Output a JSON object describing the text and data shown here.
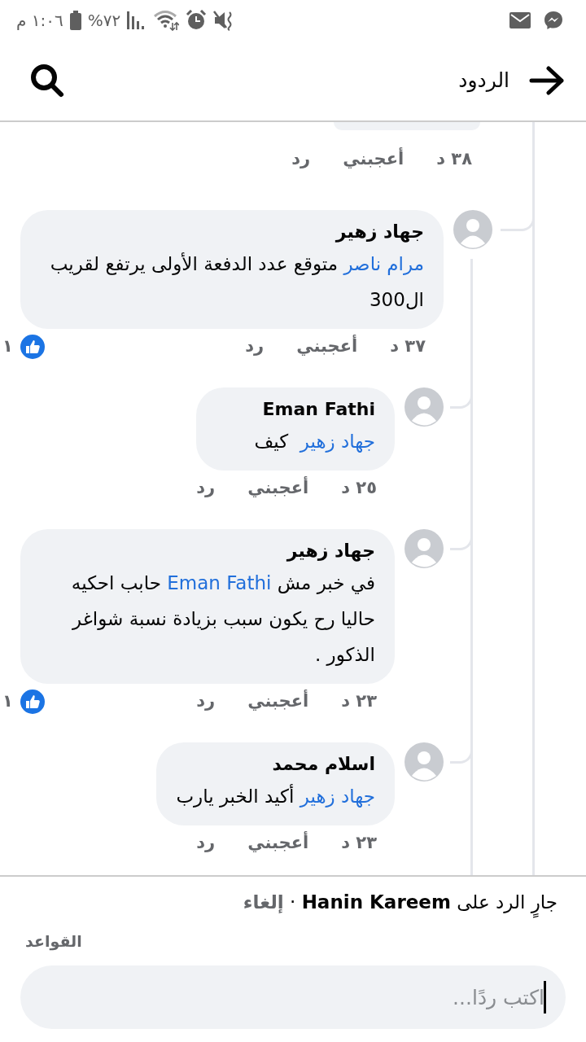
{
  "status_bar": {
    "time": "١:٠٦ م",
    "battery": "٧٢%"
  },
  "header": {
    "title": "الردود"
  },
  "thread": {
    "time": "٣٨ د",
    "like": "أعجبني",
    "reply": "رد",
    "replies": [
      {
        "author": "جهاد زهير",
        "body": [
          {
            "kind": "mention",
            "text": "مرام ناصر"
          },
          {
            "kind": "text",
            "text": " متوقع عدد الدفعة الأولى يرتفع لقريب ال300"
          }
        ],
        "time": "٣٧ د",
        "like": "أعجبني",
        "reply": "رد",
        "reactions": "١",
        "replies": [
          {
            "author": "Eman Fathi",
            "body": [
              {
                "kind": "mention",
                "text": "جهاد زهير"
              },
              {
                "kind": "text",
                "text": "  كيف"
              }
            ],
            "time": "٢٥ د",
            "like": "أعجبني",
            "reply": "رد"
          },
          {
            "author": "جهاد زهير",
            "body": [
              {
                "kind": "text",
                "text": "في خبر مش "
              },
              {
                "kind": "mention",
                "text": "Eman Fathi"
              },
              {
                "kind": "text",
                "text": " حابب احكيه حاليا رح يكون سبب بزيادة نسبة شواغر الذكور ."
              }
            ],
            "time": "٢٣ د",
            "like": "أعجبني",
            "reply": "رد",
            "reactions": "١"
          },
          {
            "author": "اسلام محمد",
            "body": [
              {
                "kind": "mention",
                "text": "جهاد زهير"
              },
              {
                "kind": "text",
                "text": " أكيد الخبر يارب"
              }
            ],
            "time": "٢٣ د",
            "like": "أعجبني",
            "reply": "رد"
          }
        ]
      }
    ]
  },
  "reply_bar": {
    "prefix": "جارٍ الرد على",
    "name": "Hanin Kareem",
    "separator": "·",
    "cancel": "إلغاء"
  },
  "rules_link": "القواعد",
  "composer": {
    "placeholder": "اكتب ردًا..."
  }
}
